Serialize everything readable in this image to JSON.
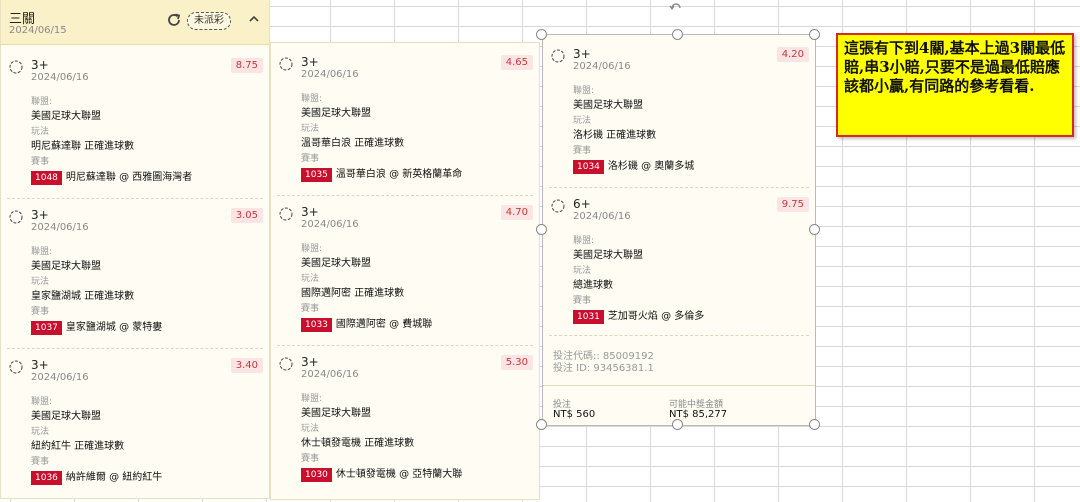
{
  "ticket": {
    "title": "三關",
    "date": "2024/06/15",
    "status_pill": "未派彩",
    "labels": {
      "league": "聯盟:",
      "play": "玩法",
      "event": "賽事"
    }
  },
  "bets": [
    {
      "legs": "3+",
      "date": "2024/06/16",
      "odds": "8.75",
      "league": "美國足球大聯盟",
      "play": "明尼蘇達聯 正確進球數",
      "match_id": "1048",
      "match": "明尼蘇達聯 @ 西雅圖海灣者"
    },
    {
      "legs": "3+",
      "date": "2024/06/16",
      "odds": "3.05",
      "league": "美國足球大聯盟",
      "play": "皇家鹽湖城 正確進球數",
      "match_id": "1037",
      "match": "皇家鹽湖城 @ 蒙特婁"
    },
    {
      "legs": "3+",
      "date": "2024/06/16",
      "odds": "3.40",
      "league": "美國足球大聯盟",
      "play": "紐約紅牛 正確進球數",
      "match_id": "1036",
      "match": "納許維爾 @ 紐約紅牛"
    },
    {
      "legs": "3+",
      "date": "2024/06/16",
      "odds": "4.65",
      "league": "美國足球大聯盟",
      "play": "溫哥華白浪 正確進球數",
      "match_id": "1035",
      "match": "溫哥華白浪 @ 新英格蘭革命"
    },
    {
      "legs": "3+",
      "date": "2024/06/16",
      "odds": "4.70",
      "league": "美國足球大聯盟",
      "play": "國際邁阿密 正確進球數",
      "match_id": "1033",
      "match": "國際邁阿密 @ 費城聯"
    },
    {
      "legs": "3+",
      "date": "2024/06/16",
      "odds": "5.30",
      "league": "美國足球大聯盟",
      "play": "休士頓發電機 正確進球數",
      "match_id": "1030",
      "match": "休士頓發電機 @ 亞特蘭大聯"
    },
    {
      "legs": "3+",
      "date": "2024/06/16",
      "odds": "4.20",
      "league": "美國足球大聯盟",
      "play": "洛杉磯 正確進球數",
      "match_id": "1034",
      "match": "洛杉磯 @ 奧蘭多城"
    },
    {
      "legs": "6+",
      "date": "2024/06/16",
      "odds": "9.75",
      "league": "美國足球大聯盟",
      "play": "總進球數",
      "match_id": "1031",
      "match": "芝加哥火焰 @ 多倫多"
    }
  ],
  "summary": {
    "bet_code": "投注代碼:: 85009192",
    "bet_id": "投注 ID: 93456381.1",
    "stake_label": "投注",
    "stake_value": "NT$ 560",
    "payout_label": "可能中獎金額",
    "payout_value": "NT$ 85,277"
  },
  "note": {
    "text": "這張有下到4關,基本上過3關最低賠,串3小賠,只要不是過最低賠應該都小贏,有同路的參考看看."
  },
  "colors": {
    "badge": "#c8102e",
    "odds": "#c23b3b",
    "note_bg": "#ffff00",
    "note_border": "#d42a2a",
    "header_bg": "#fbf1c8"
  }
}
